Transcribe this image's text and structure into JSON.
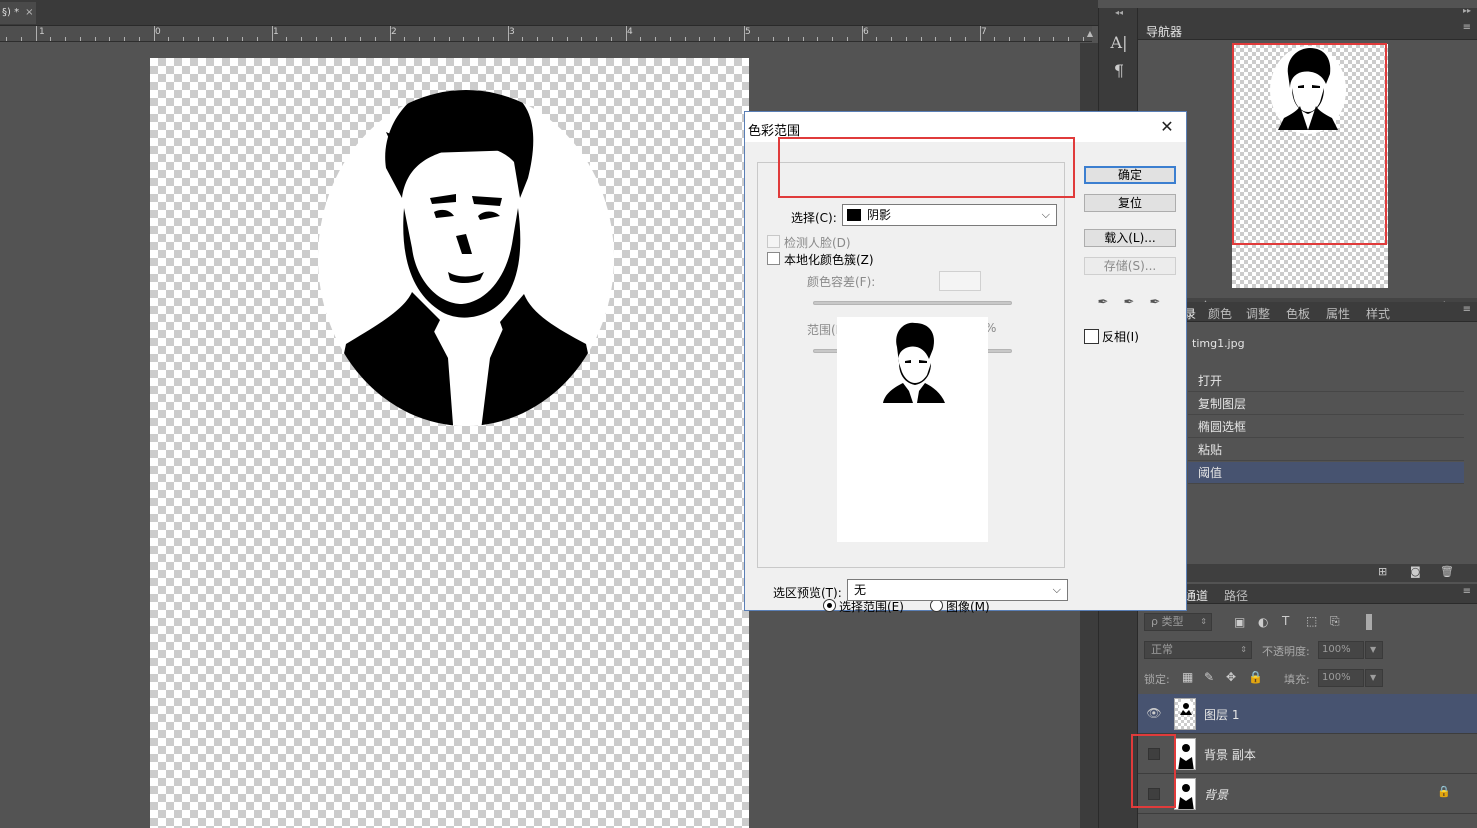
{
  "document": {
    "tab_label": "§) *",
    "ruler_labels": [
      "1",
      "0",
      "1",
      "2",
      "3",
      "4",
      "5",
      "6",
      "7"
    ]
  },
  "toolstrip": {
    "char_icon_label": "A|",
    "para_icon_label": "¶"
  },
  "navigator": {
    "tab": "导航器"
  },
  "history": {
    "tabs": [
      "录",
      "颜色",
      "调整",
      "色板",
      "属性",
      "样式"
    ],
    "doc": "timg1.jpg",
    "items": [
      "打开",
      "复制图层",
      "椭圆选框",
      "粘贴",
      "阈值"
    ],
    "active_index": 4
  },
  "layers": {
    "tabs": [
      "通道",
      "路径"
    ],
    "filter_kind": "类型",
    "blend_mode": "正常",
    "opacity_label": "不透明度:",
    "opacity_value": "100%",
    "lock_label": "锁定:",
    "fill_label": "填充:",
    "fill_value": "100%",
    "rows": [
      {
        "name": "图层 1",
        "visible": true,
        "active": true
      },
      {
        "name": "背景 副本",
        "visible": false,
        "active": false
      },
      {
        "name": "背景",
        "visible": false,
        "active": false,
        "locked": true
      }
    ]
  },
  "dialog": {
    "title": "色彩范围",
    "select_label": "选择(C):",
    "select_value": "阴影",
    "detect_faces": "检测人脸(D)",
    "localized": "本地化颜色簇(Z)",
    "fuzziness_label": "颜色容差(F):",
    "range_label": "范围(R):",
    "range_unit": "%",
    "radio_selection": "选择范围(E)",
    "radio_image": "图像(M)",
    "preview_label": "选区预览(T):",
    "preview_value": "无",
    "buttons": {
      "ok": "确定",
      "reset": "复位",
      "load": "载入(L)...",
      "save": "存储(S)..."
    },
    "invert": "反相(I)",
    "colors": {
      "accent": "#3c7fd0",
      "highlight_box": "#e03b3b"
    }
  }
}
